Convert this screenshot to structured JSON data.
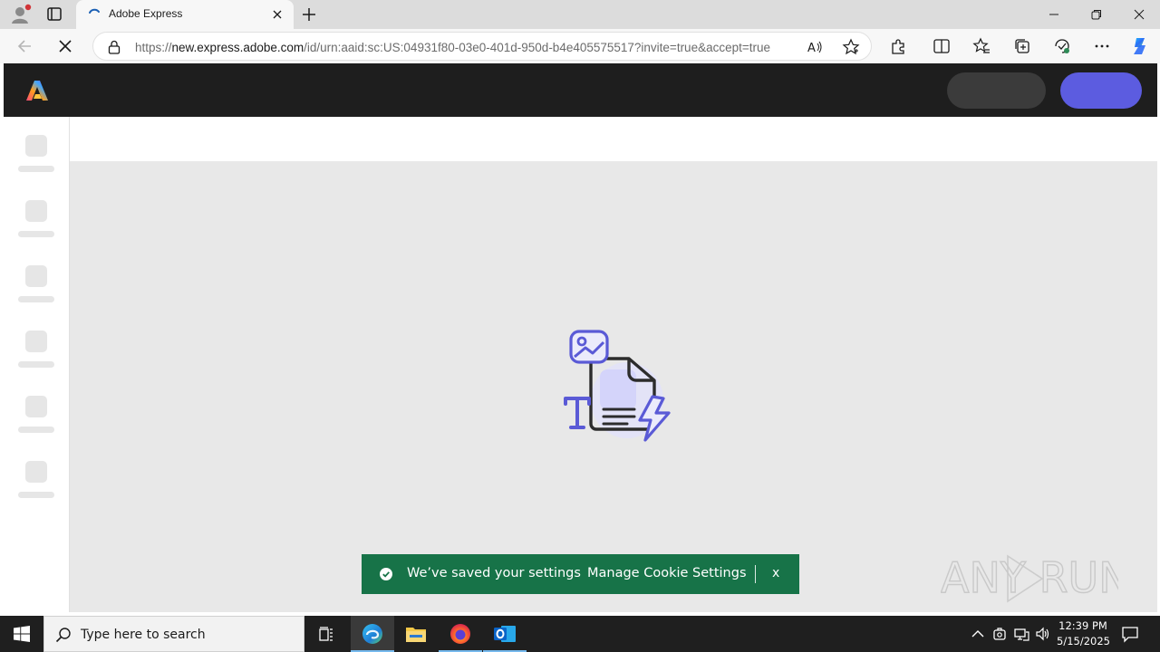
{
  "browser": {
    "tab": {
      "title": "Adobe Express"
    },
    "address": {
      "scheme": "https://",
      "host": "new.express.adobe.com",
      "path": "/id/urn:aaid:sc:US:04931f80-03e0-401d-950d-b4e405575517?invite=true&accept=true"
    },
    "icons": [
      "profile-icon",
      "tab-actions-icon",
      "loading-spinner-icon",
      "close-icon",
      "plus-icon",
      "minimize-icon",
      "restore-icon",
      "close-window-icon",
      "back-arrow-icon",
      "stop-loading-icon",
      "lock-icon",
      "read-aloud-icon",
      "favorite-star-icon",
      "extensions-icon",
      "split-screen-icon",
      "favorites-icon",
      "collections-icon",
      "browser-essentials-icon",
      "more-icon",
      "copilot-icon"
    ]
  },
  "app": {
    "name": "Adobe Express",
    "state": "loading",
    "header_buttons": [
      "placeholder-gray",
      "placeholder-blue"
    ],
    "rail_placeholders": 6,
    "colors": {
      "header": "#1e1e1e",
      "accent": "#5c5ce0",
      "canvas": "#e8e8e8"
    }
  },
  "toast": {
    "message": "We’ve saved your settings",
    "link": "Manage Cookie Settings",
    "close": "x",
    "color": "#177348"
  },
  "watermark": {
    "text": "ANY RUN"
  },
  "taskbar": {
    "search_placeholder": "Type here to search",
    "apps": [
      "task-view-icon",
      "edge-icon",
      "file-explorer-icon",
      "firefox-icon",
      "outlook-icon"
    ],
    "clock": {
      "time": "12:39 PM",
      "date": "5/15/2025"
    }
  }
}
